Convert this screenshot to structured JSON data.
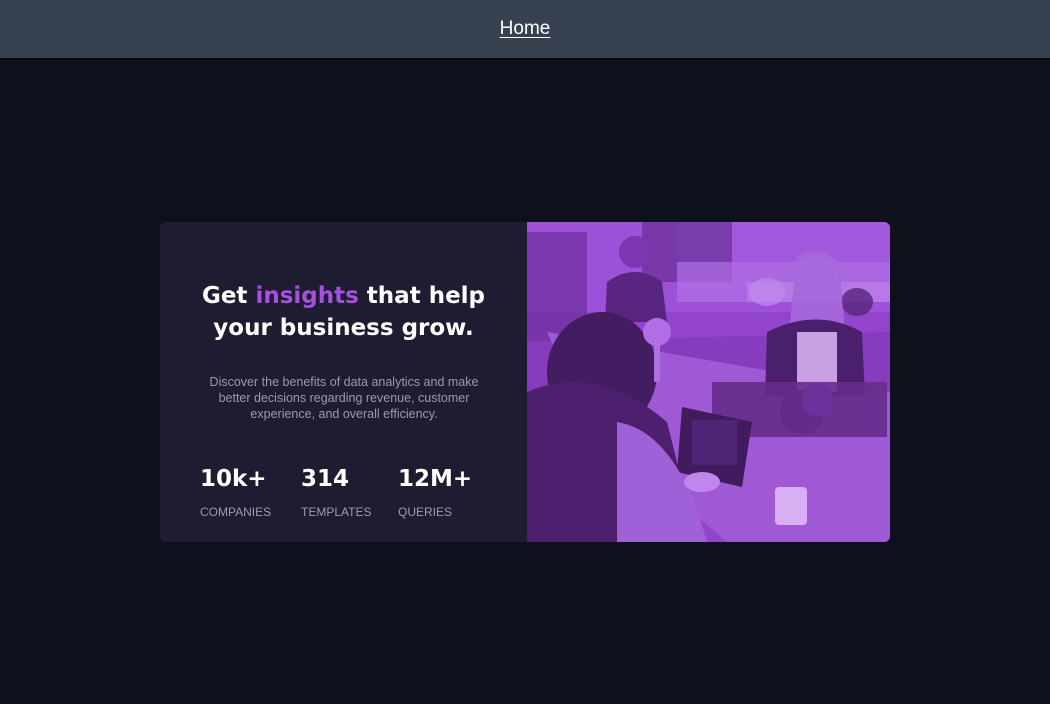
{
  "nav": {
    "home_label": "Home"
  },
  "card": {
    "headline_pre": "Get ",
    "headline_accent": "insights",
    "headline_post_line1": " that help",
    "headline_line2": "your business grow.",
    "description": "Discover the benefits of data analytics and make better decisions regarding revenue, customer experience, and overall efficiency.",
    "stats": [
      {
        "value": "10k+",
        "label": "COMPANIES"
      },
      {
        "value": "314",
        "label": "TEMPLATES"
      },
      {
        "value": "12M+",
        "label": "QUERIES"
      }
    ],
    "image": {
      "subject": "people working at an office table",
      "overlay_color": "#a74fde"
    }
  },
  "colors": {
    "page_bg": "#0e101b",
    "topbar_bg": "#384150",
    "card_bg": "#1d1c30",
    "accent": "#a74fde",
    "muted_text": "#9a9bac"
  }
}
